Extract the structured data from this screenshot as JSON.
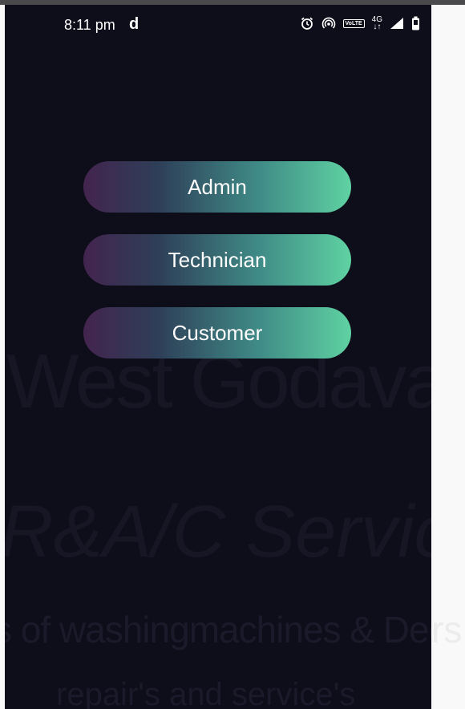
{
  "status_bar": {
    "time": "8:11 pm",
    "app_indicator": "d",
    "volte_label": "VoLTE",
    "network_label": "4G",
    "icons": [
      "alarm-icon",
      "hotspot-icon",
      "volte-icon",
      "network-4g-icon",
      "signal-icon",
      "battery-icon"
    ]
  },
  "background": {
    "line1": "West Godavari",
    "line2": "R&A/C Service",
    "line3": "s of washingmachines & Deepfreze",
    "line3_overflow": "rs",
    "line4": "repair's and service's"
  },
  "roles": {
    "admin": "Admin",
    "technician": "Technician",
    "customer": "Customer"
  },
  "colors": {
    "background": "#0e0d1a",
    "gradient_start": "#43244e",
    "gradient_end": "#5fd2a2",
    "text": "#ffffff"
  }
}
